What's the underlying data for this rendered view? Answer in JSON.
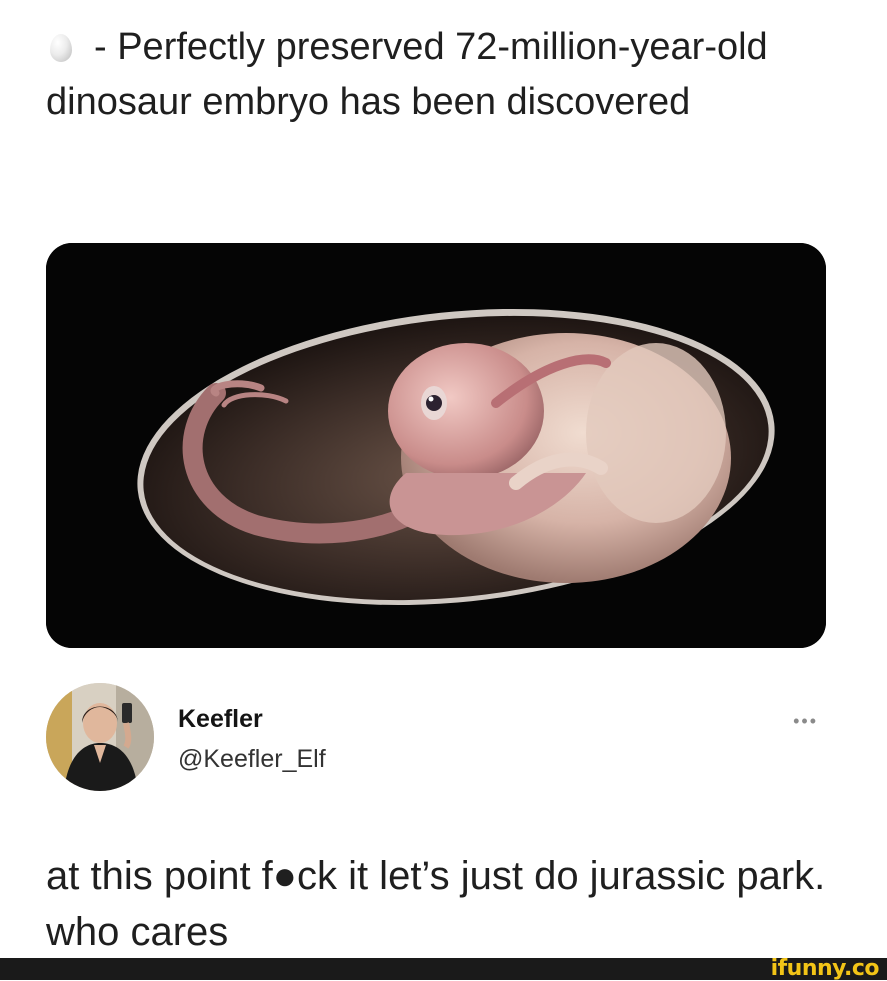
{
  "post": {
    "headline_icon": "egg-icon",
    "headline": "- Perfectly preserved 72-million-year-old dinosaur embryo has been discovered"
  },
  "media": {
    "subject": "dinosaur embryo curled inside an egg",
    "background_color": "#050505"
  },
  "tweet": {
    "display_name": "Keefler",
    "handle": "@Keefler_Elf",
    "more_icon": "ellipsis-icon",
    "more_label": "•••",
    "text": "at this point f●ck it let’s just do jurassic park. who cares"
  },
  "watermark": {
    "text": "ifunny.co",
    "color": "#f2c417"
  }
}
